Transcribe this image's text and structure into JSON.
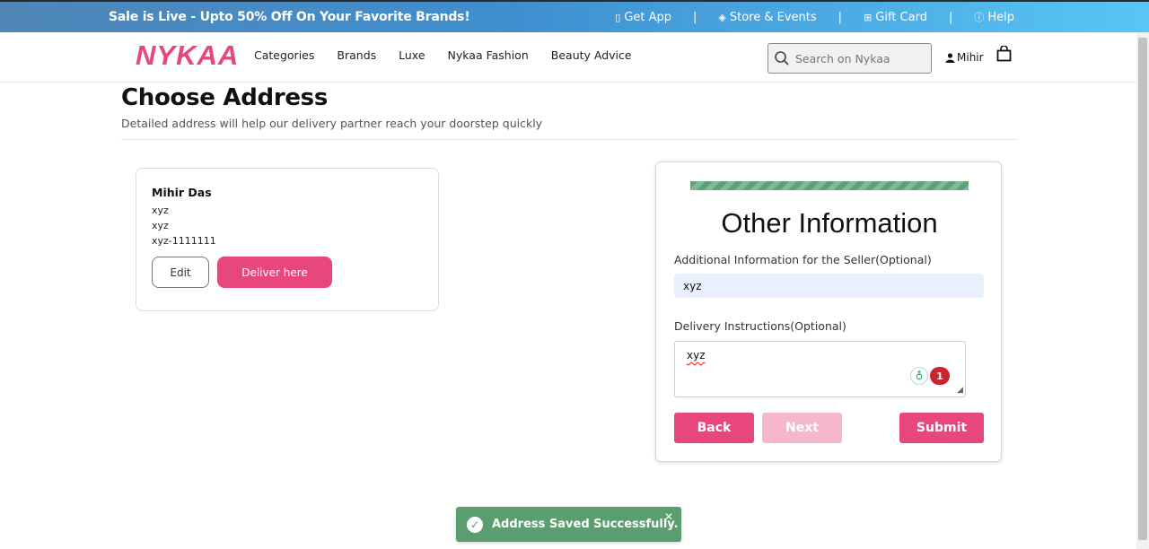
{
  "promo": {
    "text": "Sale is Live - Upto 50% Off On Your Favorite Brands!",
    "links": [
      {
        "icon": "phone-icon",
        "label": "Get App"
      },
      {
        "icon": "location-icon",
        "label": "Store & Events"
      },
      {
        "icon": "gift-icon",
        "label": "Gift Card"
      },
      {
        "icon": "help-icon",
        "label": "Help"
      }
    ],
    "separator": "|"
  },
  "nav": {
    "logo": "NYKAA",
    "menu": [
      "Categories",
      "Brands",
      "Luxe",
      "Nykaa Fashion",
      "Beauty Advice"
    ],
    "search_placeholder": "Search on Nykaa",
    "user_name": "Mihir"
  },
  "page": {
    "title": "Choose Address",
    "subtitle": "Detailed address will help our delivery partner reach your doorstep quickly"
  },
  "address": {
    "name": "Mihir Das",
    "lines": [
      "xyz",
      "xyz",
      "xyz-1111111"
    ],
    "edit_label": "Edit",
    "deliver_label": "Deliver here"
  },
  "form": {
    "title": "Other Information",
    "seller_label": "Additional Information for the Seller(Optional)",
    "seller_value": "xyz",
    "delivery_label": "Delivery Instructions(Optional)",
    "delivery_value": "xyz",
    "grammar_count": "1",
    "back_label": "Back",
    "next_label": "Next",
    "submit_label": "Submit"
  },
  "toast": {
    "message": "Address Saved Successfully.",
    "close": "✕"
  },
  "colors": {
    "brand": "#e8477d",
    "brand_light": "#f6b6cd",
    "success": "#5a9e6f"
  }
}
